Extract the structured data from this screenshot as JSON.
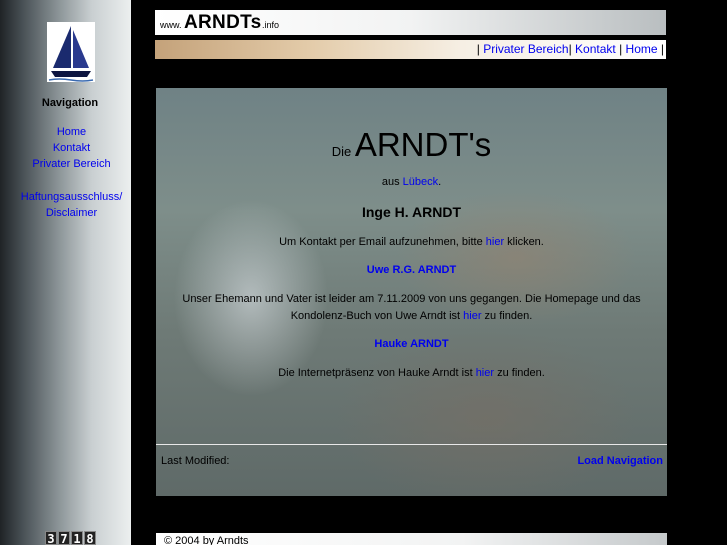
{
  "sidebar": {
    "nav_title": "Navigation",
    "links": [
      "Home",
      "Kontakt",
      "Privater Bereich",
      "Haftungsausschluss/",
      "Disclaimer"
    ],
    "counter": [
      "3",
      "7",
      "1",
      "8"
    ]
  },
  "header": {
    "www": "www.",
    "brand": "ARNDTs",
    "tld": ".info"
  },
  "topnav": {
    "sep1": "| ",
    "private": "Privater Bereich",
    "sep2": "| ",
    "contact": "Kontakt",
    "sep3": " | ",
    "home": "Home",
    "sep4": " |"
  },
  "main": {
    "title_prefix": "Die ",
    "title": "ARNDT's",
    "from_prefix": "aus ",
    "from_city": "Lübeck",
    "from_suffix": ".",
    "person1": "Inge H. ARNDT",
    "contact_before": "Um Kontakt per Email aufzunehmen, bitte ",
    "contact_link": "hier",
    "contact_after": " klicken.",
    "person2": "Uwe R.G. ARNDT",
    "uwe_line1": "Unser Ehemann und Vater ist leider am 7.11.2009 von uns gegangen. Die Homepage und das",
    "uwe_line2_before": "Kondolenz-Buch von Uwe Arndt ist ",
    "uwe_link": "hier",
    "uwe_line2_after": " zu finden.",
    "person3": "Hauke ARNDT",
    "hauke_before": "Die Internetpräsenz von Hauke Arndt ist ",
    "hauke_link": "hier",
    "hauke_after": " zu finden.",
    "last_modified": "Last Modified:",
    "load_navigation": "Load Navigation"
  },
  "footer": {
    "copyright": "© 2004 by Arndts"
  },
  "colors": {
    "link": "#0000ee",
    "background": "#000000"
  }
}
